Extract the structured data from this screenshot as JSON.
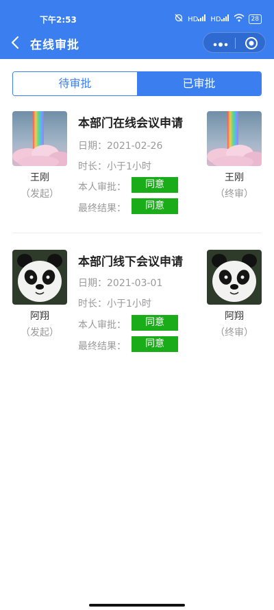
{
  "status_bar": {
    "time": "下午2:53",
    "signal1": "HD",
    "signal2": "HD",
    "battery": "28"
  },
  "nav": {
    "title": "在线审批"
  },
  "tabs": [
    {
      "label": "待审批"
    },
    {
      "label": "已审批"
    }
  ],
  "colors": {
    "primary": "#3a7ef0",
    "approve": "#1aad19"
  },
  "cards": [
    {
      "title": "本部门在线会议申请",
      "date_label": "日期：",
      "date": "2021-02-26",
      "duration_label": "时长：",
      "duration": "小于1小时",
      "my_approval_label": "本人审批：",
      "my_approval": "同意",
      "final_result_label": "最终结果：",
      "final_result": "同意",
      "initiator": {
        "name": "王刚",
        "role": "（发起）",
        "avatar": "rainbow-cloud-icon"
      },
      "final_approver": {
        "name": "王刚",
        "role": "（终审）",
        "avatar": "rainbow-cloud-icon"
      }
    },
    {
      "title": "本部门线下会议申请",
      "date_label": "日期：",
      "date": "2021-03-01",
      "duration_label": "时长：",
      "duration": "小于1小时",
      "my_approval_label": "本人审批：",
      "my_approval": "同意",
      "final_result_label": "最终结果：",
      "final_result": "同意",
      "initiator": {
        "name": "阿翔",
        "role": "（发起）",
        "avatar": "panda-icon"
      },
      "final_approver": {
        "name": "阿翔",
        "role": "（终审）",
        "avatar": "panda-icon"
      }
    }
  ]
}
